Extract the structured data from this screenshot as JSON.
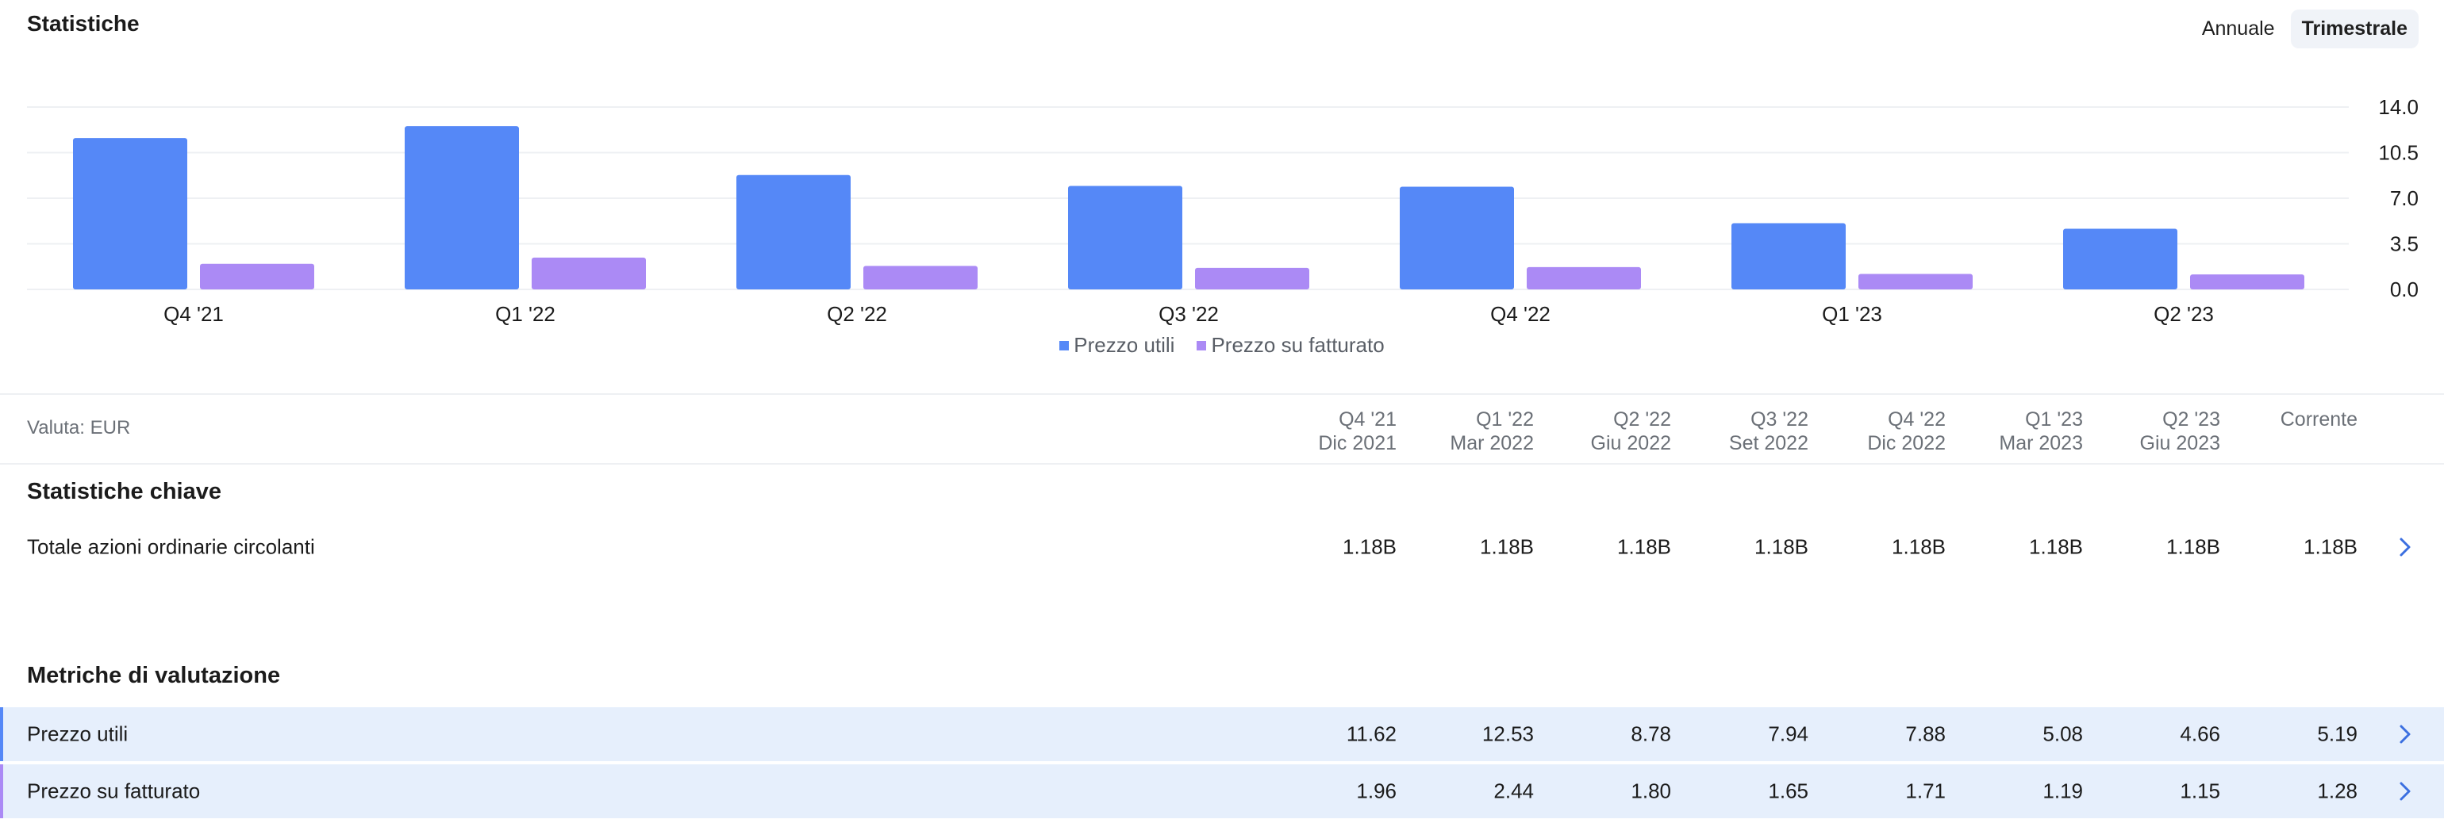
{
  "header": {
    "title": "Statistiche",
    "period_options": [
      "Annuale",
      "Trimestrale"
    ],
    "active_period": "Trimestrale"
  },
  "chart_data": {
    "type": "bar",
    "categories": [
      "Q4 '21",
      "Q1 '22",
      "Q2 '22",
      "Q3 '22",
      "Q4 '22",
      "Q1 '23",
      "Q2 '23"
    ],
    "series": [
      {
        "name": "Prezzo utili",
        "color": "#5588f7",
        "values": [
          11.62,
          12.53,
          8.78,
          7.94,
          7.88,
          5.08,
          4.66
        ]
      },
      {
        "name": "Prezzo su fatturato",
        "color": "#ab8af5",
        "values": [
          1.96,
          2.44,
          1.8,
          1.65,
          1.71,
          1.19,
          1.15
        ]
      }
    ],
    "ylim": [
      0,
      14
    ],
    "yticks": [
      "14.0",
      "10.5",
      "7.0",
      "3.5",
      "0.0"
    ],
    "ytick_values": [
      14,
      10.5,
      7,
      3.5,
      0
    ],
    "grid": true,
    "legend_position": "bottom-center",
    "y_axis_side": "right"
  },
  "table": {
    "currency_label": "Valuta: EUR",
    "columns": [
      {
        "quarter": "Q4 '21",
        "date": "Dic 2021"
      },
      {
        "quarter": "Q1 '22",
        "date": "Mar 2022"
      },
      {
        "quarter": "Q2 '22",
        "date": "Giu 2022"
      },
      {
        "quarter": "Q3 '22",
        "date": "Set 2022"
      },
      {
        "quarter": "Q4 '22",
        "date": "Dic 2022"
      },
      {
        "quarter": "Q1 '23",
        "date": "Mar 2023"
      },
      {
        "quarter": "Q2 '23",
        "date": "Giu 2023"
      },
      {
        "quarter": "Corrente",
        "date": ""
      }
    ],
    "sections": [
      {
        "title": "Statistiche chiave",
        "rows": [
          {
            "label": "Totale azioni ordinarie circolanti",
            "values": [
              "1.18B",
              "1.18B",
              "1.18B",
              "1.18B",
              "1.18B",
              "1.18B",
              "1.18B",
              "1.18B"
            ],
            "highlight": false
          }
        ]
      },
      {
        "title": "Metriche di valutazione",
        "rows": [
          {
            "label": "Prezzo utili",
            "values": [
              "11.62",
              "12.53",
              "8.78",
              "7.94",
              "7.88",
              "5.08",
              "4.66",
              "5.19"
            ],
            "highlight": true,
            "accent": "#5588f7"
          },
          {
            "label": "Prezzo su fatturato",
            "values": [
              "1.96",
              "2.44",
              "1.80",
              "1.65",
              "1.71",
              "1.19",
              "1.15",
              "1.28"
            ],
            "highlight": true,
            "accent": "#ab8af5"
          }
        ]
      }
    ]
  },
  "icons": {
    "row_chevron": "chevron-right-icon",
    "chevron_color": "#3b6fe0"
  }
}
